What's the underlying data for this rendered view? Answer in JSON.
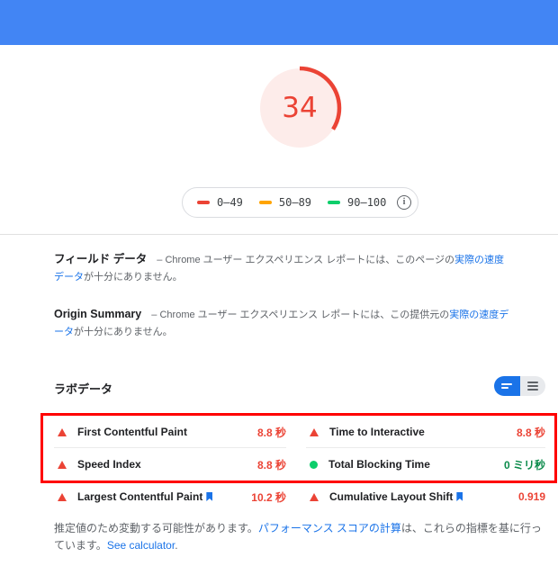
{
  "colors": {
    "topbar": "#4285f4",
    "fail": "#eb4335",
    "average": "#ffa400",
    "pass": "#0cce6b",
    "gauge_fill": "#fdecea",
    "link": "#1a73e8",
    "highlight_box": "#ff0000"
  },
  "score": {
    "value": "34",
    "fraction": 0.34
  },
  "legend": {
    "items": [
      {
        "label": "0–49",
        "status": "fail"
      },
      {
        "label": "50–89",
        "status": "average"
      },
      {
        "label": "90–100",
        "status": "pass"
      }
    ],
    "info_icon": "info-icon"
  },
  "field_data": {
    "heading": "フィールド データ",
    "text_prefix": " – Chrome ユーザー エクスペリエンス レポートには、このページの",
    "link": "実際の速度データ",
    "text_suffix": "が十分にありません。"
  },
  "origin_summary": {
    "heading": "Origin Summary",
    "text_prefix": " – Chrome ユーザー エクスペリエンス レポートには、この提供元の",
    "link": "実際の速度データ",
    "text_suffix": "が十分にありません。"
  },
  "lab_data": {
    "title": "ラボデータ",
    "metrics": [
      {
        "name": "First Contentful Paint",
        "value": "8.8 秒",
        "status": "fail",
        "bookmark": false
      },
      {
        "name": "Time to Interactive",
        "value": "8.8 秒",
        "status": "fail",
        "bookmark": false
      },
      {
        "name": "Speed Index",
        "value": "8.8 秒",
        "status": "fail",
        "bookmark": false
      },
      {
        "name": "Total Blocking Time",
        "value": "0 ミリ秒",
        "status": "pass",
        "bookmark": false
      },
      {
        "name": "Largest Contentful Paint",
        "value": "10.2 秒",
        "status": "fail",
        "bookmark": true
      },
      {
        "name": "Cumulative Layout Shift",
        "value": "0.919",
        "status": "fail",
        "bookmark": true
      }
    ]
  },
  "footnote": {
    "text_prefix": "推定値のため変動する可能性があります。",
    "link1": "パフォーマンス スコアの計算",
    "text_middle": "は、これらの指標を基に行っています。",
    "link2": "See calculator",
    "text_suffix": "."
  }
}
